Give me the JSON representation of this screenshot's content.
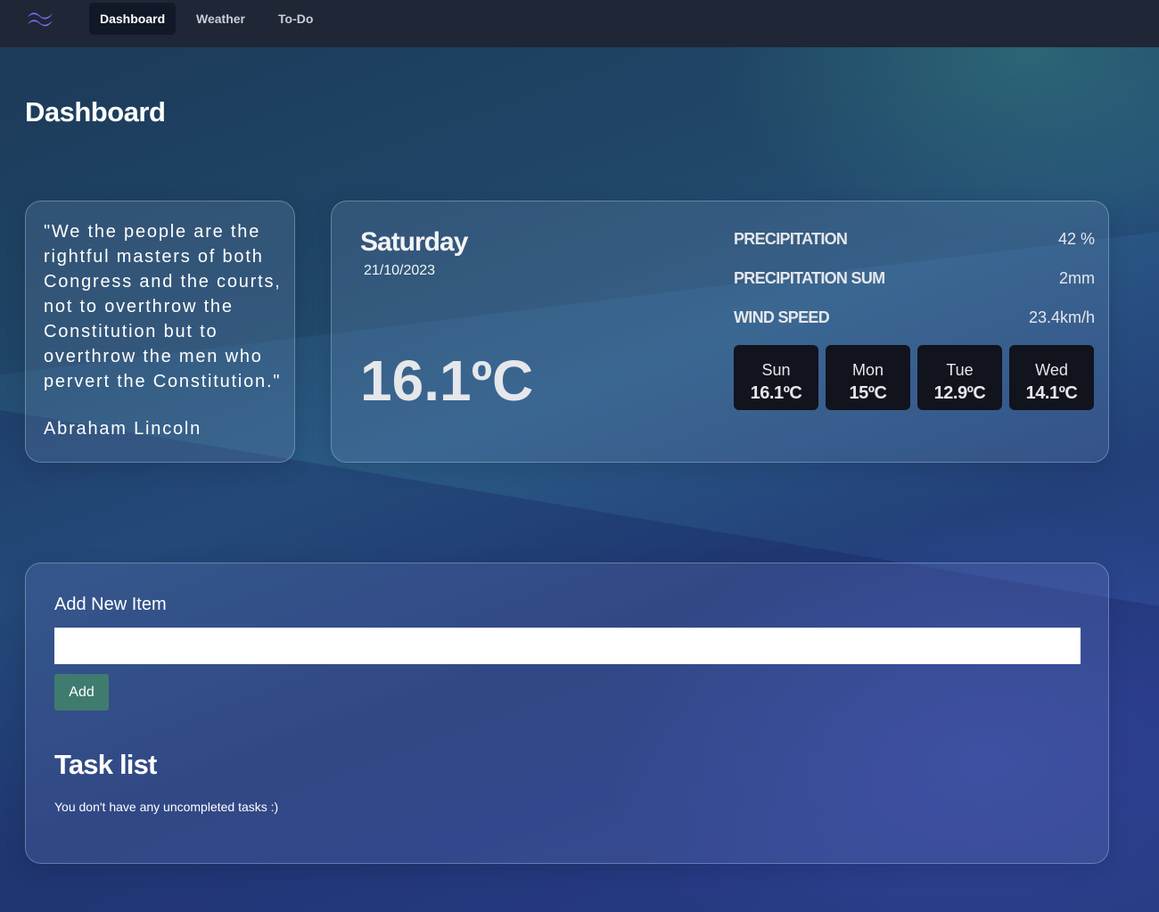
{
  "nav": {
    "logo_icon": "tailwind-wave-icon",
    "links": [
      {
        "label": "Dashboard",
        "active": true
      },
      {
        "label": "Weather",
        "active": false
      },
      {
        "label": "To-Do",
        "active": false
      }
    ]
  },
  "page": {
    "title": "Dashboard"
  },
  "quote": {
    "text": "\"We the people are the rightful masters of both Congress and the courts, not to overthrow the Constitution but to overthrow the men who pervert the Constitution.\"",
    "author": "Abraham Lincoln"
  },
  "weather": {
    "day": "Saturday",
    "date": "21/10/2023",
    "current_temp": "16.1ºC",
    "stats": [
      {
        "label": "PRECIPITATION",
        "value": "42 %"
      },
      {
        "label": "PRECIPITATION SUM",
        "value": "2mm"
      },
      {
        "label": "WIND SPEED",
        "value": "23.4km/h"
      }
    ],
    "forecast": [
      {
        "day": "Sun",
        "temp": "16.1ºC"
      },
      {
        "day": "Mon",
        "temp": "15ºC"
      },
      {
        "day": "Tue",
        "temp": "12.9ºC"
      },
      {
        "day": "Wed",
        "temp": "14.1ºC"
      }
    ]
  },
  "todo": {
    "add_label": "Add New Item",
    "input_value": "",
    "input_placeholder": "",
    "add_button": "Add",
    "list_title": "Task list",
    "empty_message": "You don't have any uncompleted tasks :)"
  },
  "colors": {
    "navbar": "#1f2636",
    "active_nav": "#111827",
    "add_button": "#3f7b6e",
    "forecast_tile": "#11131d",
    "logo": "#7c6cf0"
  }
}
